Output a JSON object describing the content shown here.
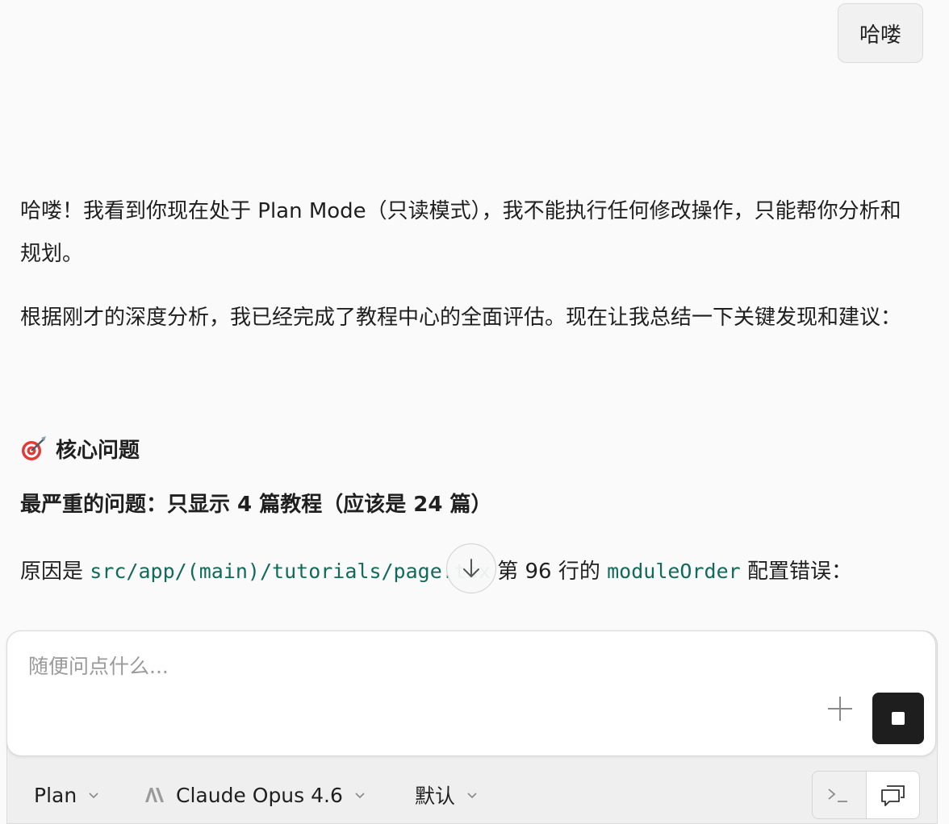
{
  "user_message": "哈喽",
  "assistant": {
    "paragraph_1": "哈喽！我看到你现在处于 Plan Mode（只读模式），我不能执行任何修改操作，只能帮你分析和规划。",
    "paragraph_2": "根据刚才的深度分析，我已经完成了教程中心的全面评估。现在让我总结一下关键发现和建议：",
    "heading": "核心问题",
    "heading_icon": "target-icon",
    "bold_line": "最严重的问题：只显示 4 篇教程（应该是 24 篇）",
    "line_prefix": "原因是 ",
    "file_path": "src/app/(main)/tutorials/page.tsx",
    "line_middle": " 第 96 行的 ",
    "code_identifier": "moduleOrder",
    "line_suffix": " 配置错误："
  },
  "composer": {
    "placeholder": "随便问点什么...",
    "value": ""
  },
  "toolbar": {
    "mode": "Plan",
    "model": "Claude Opus 4.6",
    "preset": "默认"
  },
  "colors": {
    "code_text": "#106b5a",
    "stop_button": "#1e1e1e"
  }
}
